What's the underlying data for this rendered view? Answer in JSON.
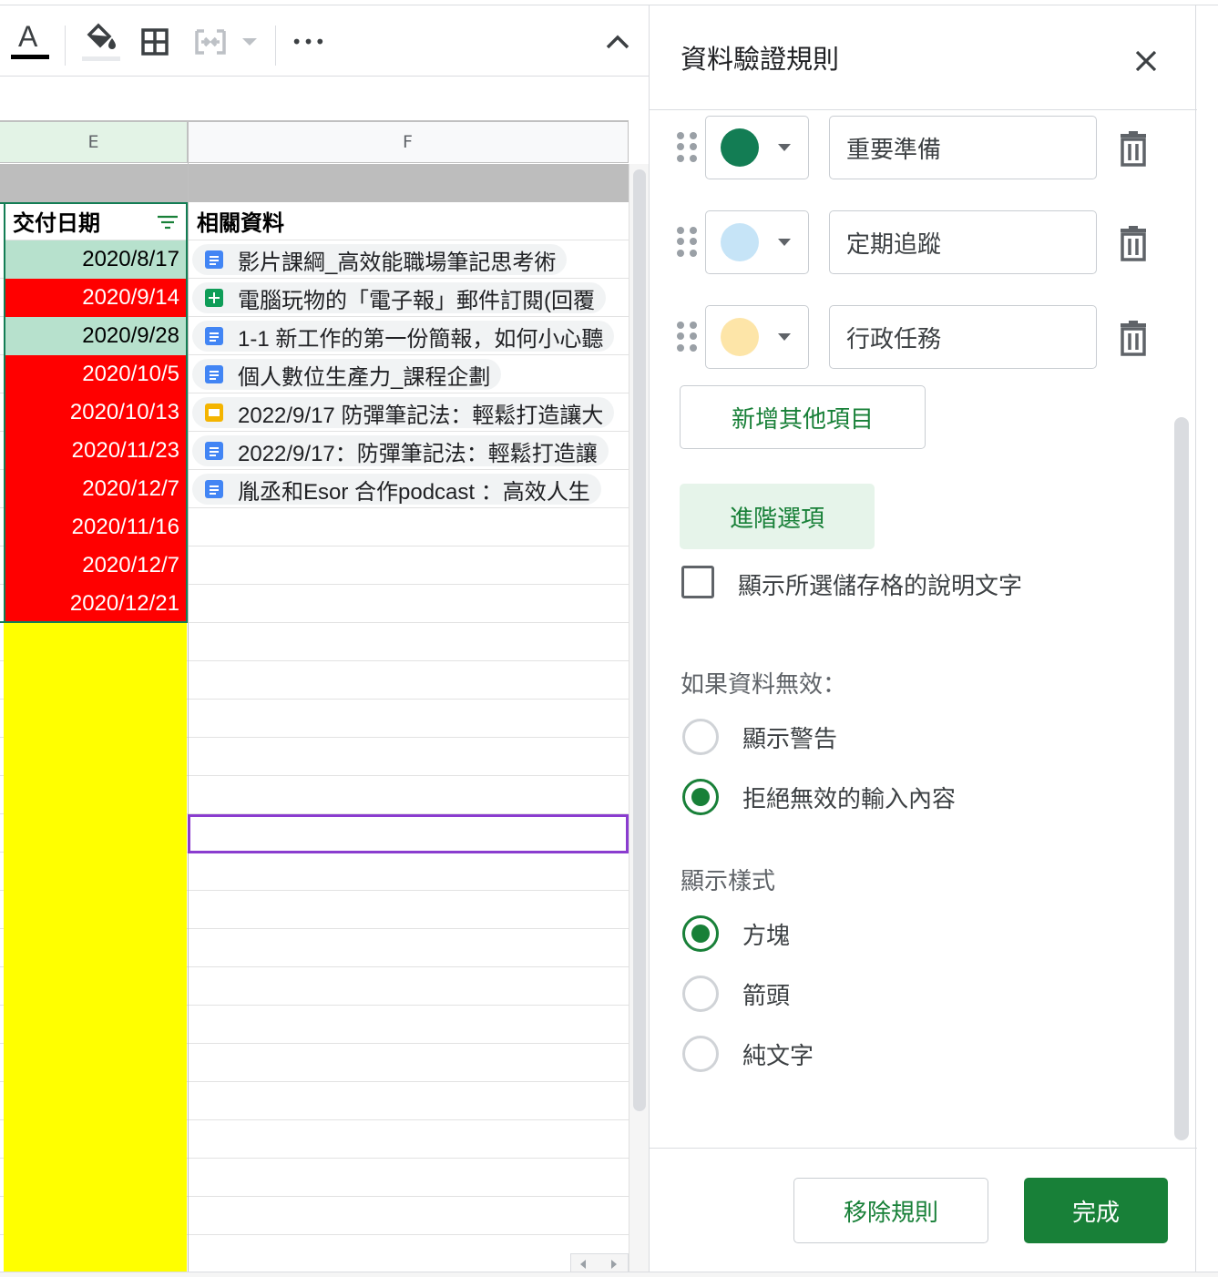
{
  "toolbar": {
    "text_color_glyph": "A",
    "more_glyph": "•••"
  },
  "columns": [
    {
      "letter": "E"
    },
    {
      "letter": "F"
    }
  ],
  "header_row": {
    "col_e": "交付日期",
    "col_f": "相關資料"
  },
  "rows": [
    {
      "date": "2020/8/17",
      "date_bg": "#b7e1cd",
      "date_color": "#000000",
      "chip": "影片課綱_高效能職場筆記思考術",
      "chip_icon": "docs-icon"
    },
    {
      "date": "2020/9/14",
      "date_bg": "#ff0000",
      "date_color": "#ffffff",
      "chip": "電腦玩物的「電子報」郵件訂閱(回覆",
      "chip_icon": "sheets-icon"
    },
    {
      "date": "2020/9/28",
      "date_bg": "#b7e1cd",
      "date_color": "#000000",
      "chip": "1-1 新工作的第一份簡報，如何小心聽",
      "chip_icon": "docs-icon"
    },
    {
      "date": "2020/10/5",
      "date_bg": "#ff0000",
      "date_color": "#ffffff",
      "chip": "個人數位生產力_課程企劃",
      "chip_icon": "docs-icon"
    },
    {
      "date": "2020/10/13",
      "date_bg": "#ff0000",
      "date_color": "#ffffff",
      "chip": "2022/9/17 防彈筆記法：輕鬆打造讓大",
      "chip_icon": "slides-icon"
    },
    {
      "date": "2020/11/23",
      "date_bg": "#ff0000",
      "date_color": "#ffffff",
      "chip": "2022/9/17：防彈筆記法：輕鬆打造讓",
      "chip_icon": "docs-icon"
    },
    {
      "date": "2020/12/7",
      "date_bg": "#ff0000",
      "date_color": "#ffffff",
      "chip": "胤丞和Esor 合作podcast ：高效人生",
      "chip_icon": "docs-icon"
    },
    {
      "date": "2020/11/16",
      "date_bg": "#ff0000",
      "date_color": "#ffffff",
      "chip": "",
      "chip_icon": ""
    },
    {
      "date": "2020/12/7",
      "date_bg": "#ff0000",
      "date_color": "#ffffff",
      "chip": "",
      "chip_icon": ""
    },
    {
      "date": "2020/12/21",
      "date_bg": "#ff0000",
      "date_color": "#ffffff",
      "chip": "",
      "chip_icon": ""
    }
  ],
  "empty_row_fill": "#ffff00",
  "panel": {
    "title": "資料驗證規則",
    "items": [
      {
        "label": "重要準備",
        "color": "#137d54"
      },
      {
        "label": "定期追蹤",
        "color": "#c6e4f7"
      },
      {
        "label": "行政任務",
        "color": "#fde5a8"
      }
    ],
    "add_item_label": "新增其他項目",
    "advanced_label": "進階選項",
    "help_text_checkbox": "顯示所選儲存格的說明文字",
    "invalid_section": "如果資料無效：",
    "invalid_options": [
      {
        "label": "顯示警告",
        "selected": false
      },
      {
        "label": "拒絕無效的輸入內容",
        "selected": true
      }
    ],
    "style_section": "顯示樣式",
    "style_options": [
      {
        "label": "方塊",
        "selected": true
      },
      {
        "label": "箭頭",
        "selected": false
      },
      {
        "label": "純文字",
        "selected": false
      }
    ],
    "remove_rule_label": "移除規則",
    "done_label": "完成"
  },
  "colors": {
    "accent_green": "#188038",
    "selection_border": "#8a3ccf"
  }
}
